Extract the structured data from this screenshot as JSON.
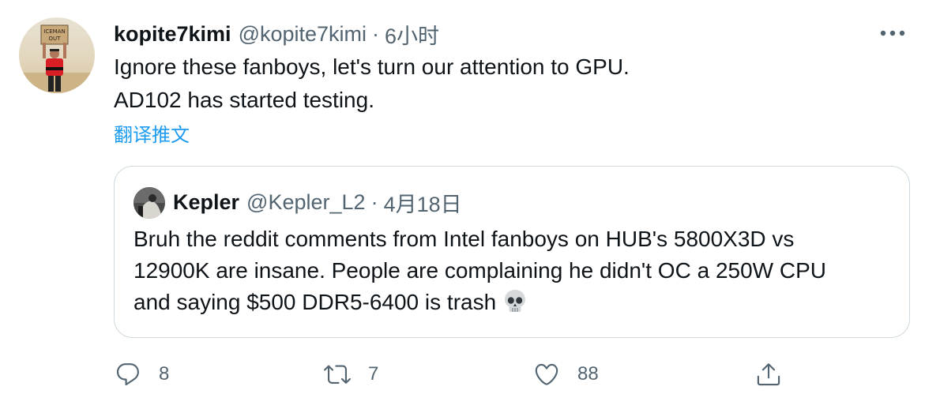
{
  "tweet": {
    "author_name": "kopite7kimi",
    "author_handle": "@kopite7kimi",
    "separator": "·",
    "time": "6小时",
    "text_lines": [
      "Ignore these fanboys, let's turn our attention to GPU.",
      "AD102 has started testing."
    ],
    "translate_label": "翻译推文",
    "more_icon": "more-horizontal-icon"
  },
  "quoted_tweet": {
    "author_name": "Kepler",
    "author_handle": "@Kepler_L2",
    "separator": "·",
    "time": "4月18日",
    "text_lines": [
      "Bruh the reddit comments from Intel fanboys on HUB's 5800X3D vs",
      "12900K are insane. People are complaining he didn't OC a 250W CPU",
      "and saying $500 DDR5-6400 is trash"
    ],
    "emoji": "skull-emoji"
  },
  "actions": {
    "reply_count": "8",
    "retweet_count": "7",
    "like_count": "88",
    "reply_icon": "reply-icon",
    "retweet_icon": "retweet-icon",
    "like_icon": "heart-icon",
    "share_icon": "share-icon"
  },
  "colors": {
    "text_primary": "#0f1419",
    "text_secondary": "#536471",
    "link": "#1d9bf0",
    "border": "#cfd9de"
  }
}
